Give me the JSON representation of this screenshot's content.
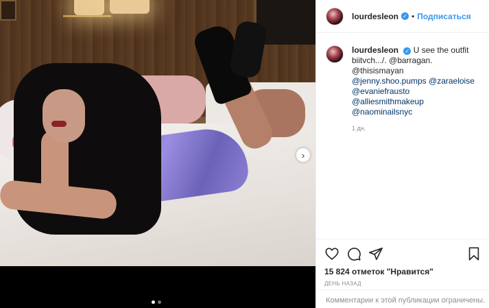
{
  "header": {
    "username": "lourdesleon",
    "separator": "•",
    "follow_label": "Подписаться"
  },
  "caption": {
    "username": "lourdesleon",
    "text": "U see the outfit biitvch.../. @barragan. @thisismayan",
    "mentions": [
      "@jenny.shoo.pumps @zaraeloise",
      "@evaniefrausto @alliesmithmakeup",
      "@naominailsnyc"
    ],
    "time": "1 дн."
  },
  "actions": {
    "icons": [
      "heart-icon",
      "comment-icon",
      "share-icon",
      "bookmark-icon"
    ]
  },
  "likes": "15 824 отметок \"Нравится\"",
  "posted_ago": "ДЕНЬ НАЗАД",
  "comments_disabled": "Комментарии к этой публикации ограничены.",
  "carousel": {
    "next_icon": "chevron-right-icon",
    "current_slide": 1,
    "total_slides": 2
  },
  "colors": {
    "accent": "#3897f0",
    "text": "#262626",
    "muted": "#8e8e8e",
    "mention": "#003569"
  }
}
